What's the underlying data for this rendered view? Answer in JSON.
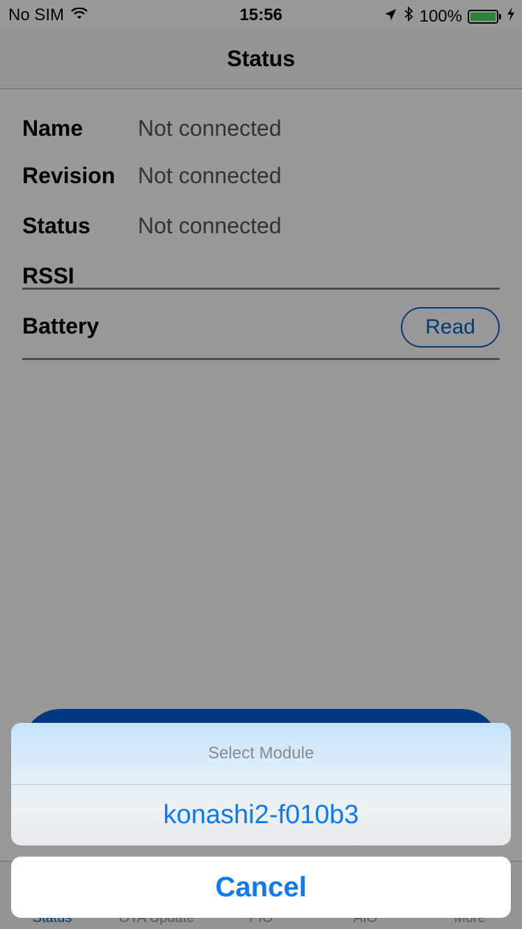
{
  "status_bar": {
    "carrier": "No SIM",
    "time": "15:56",
    "battery_percent": "100%",
    "icons": [
      "wifi-icon",
      "location-arrow-icon",
      "bluetooth-icon",
      "battery-icon",
      "charging-bolt-icon"
    ]
  },
  "navbar": {
    "title": "Status"
  },
  "info": {
    "name_label": "Name",
    "name_value": "Not connected",
    "revision_label": "Revision",
    "revision_value": "Not connected",
    "status_label": "Status",
    "status_value": "Not connected",
    "rssi_label": "RSSI",
    "battery_label": "Battery",
    "read_label": "Read"
  },
  "tabs": [
    {
      "label": "Status",
      "active": true
    },
    {
      "label": "OTA Update",
      "active": false
    },
    {
      "label": "PIO",
      "active": false
    },
    {
      "label": "AIO",
      "active": false
    },
    {
      "label": "More",
      "active": false
    }
  ],
  "action_sheet": {
    "title": "Select Module",
    "option": "konashi2-f010b3",
    "cancel": "Cancel"
  },
  "colors": {
    "accent": "#0a7af5",
    "button_blue": "#0060c8",
    "battery_green": "#4cd964"
  }
}
